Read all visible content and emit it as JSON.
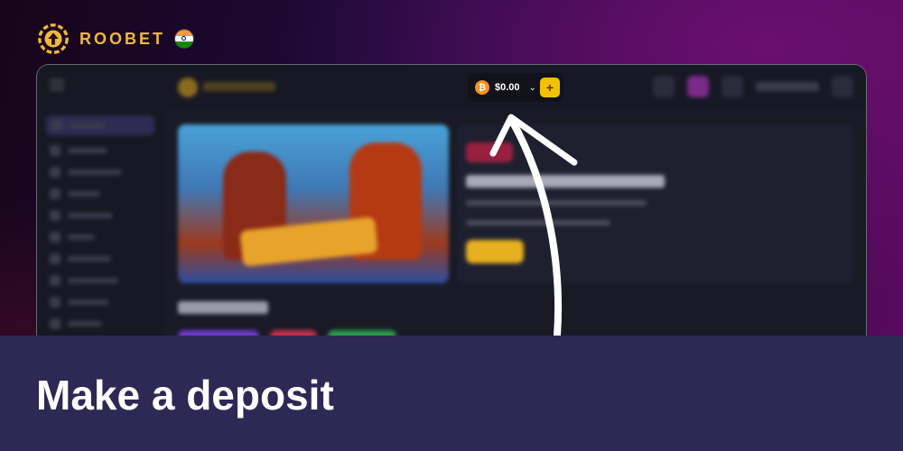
{
  "brand": {
    "name": "ROOBET",
    "flag": "india-flag"
  },
  "wallet": {
    "currency_icon": "bitcoin-icon",
    "balance": "$0.00",
    "deposit_symbol": "+"
  },
  "caption": "Make a deposit",
  "colors": {
    "accent": "#f3b73a",
    "deposit_button": "#f5c000",
    "banner": "#2e2855",
    "frame_bg": "#191a26"
  }
}
